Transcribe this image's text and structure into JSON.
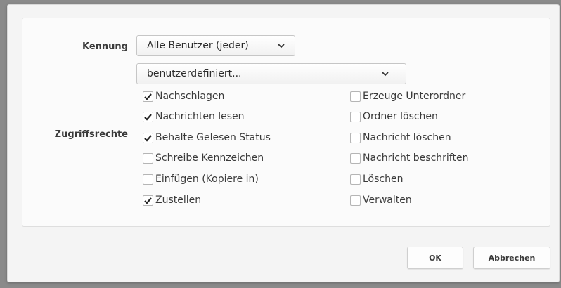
{
  "form": {
    "identifier_label": "Kennung",
    "identifier_value": "Alle Benutzer (jeder)",
    "preset_value": "benutzerdefiniert...",
    "rights_label": "Zugriffsrechte"
  },
  "rights": {
    "left": [
      {
        "label": "Nachschlagen",
        "checked": true
      },
      {
        "label": "Nachrichten lesen",
        "checked": true
      },
      {
        "label": "Behalte Gelesen Status",
        "checked": true
      },
      {
        "label": "Schreibe Kennzeichen",
        "checked": false
      },
      {
        "label": "Einfügen (Kopiere in)",
        "checked": false
      },
      {
        "label": "Zustellen",
        "checked": true
      }
    ],
    "right": [
      {
        "label": "Erzeuge Unterordner",
        "checked": false
      },
      {
        "label": "Ordner löschen",
        "checked": false
      },
      {
        "label": "Nachricht löschen",
        "checked": false
      },
      {
        "label": "Nachricht beschriften",
        "checked": false
      },
      {
        "label": "Löschen",
        "checked": false
      },
      {
        "label": "Verwalten",
        "checked": false
      }
    ]
  },
  "buttons": {
    "ok": "OK",
    "cancel": "Abbrechen"
  },
  "icons": {
    "dropdown": "chevron-down-icon",
    "check": "checkmark-icon"
  }
}
